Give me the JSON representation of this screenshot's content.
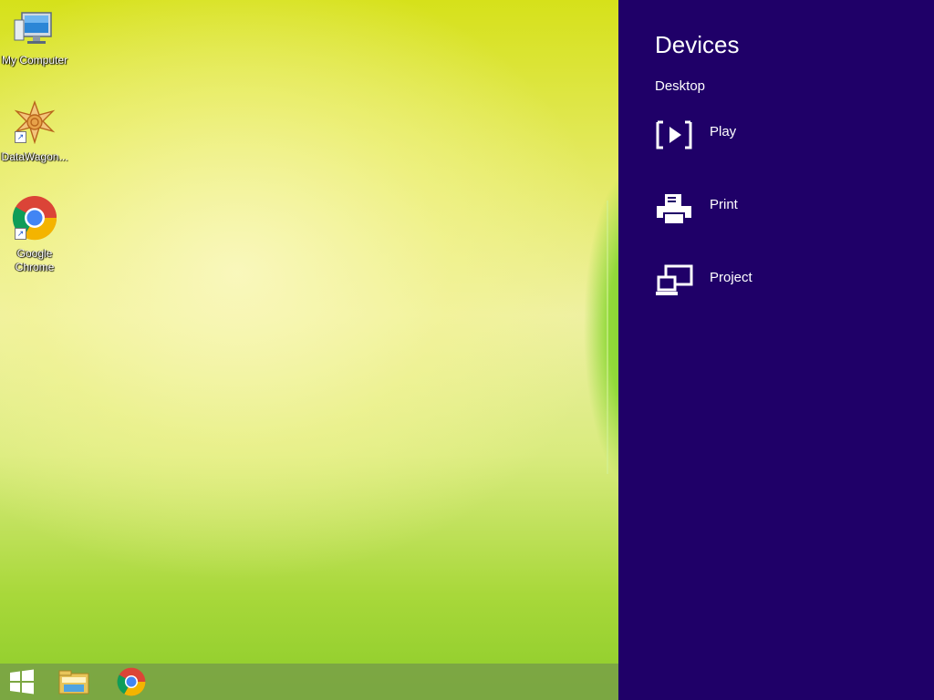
{
  "desktop": {
    "icons": [
      {
        "label": "My Computer",
        "icon": "my-computer-icon"
      },
      {
        "label": "DataWagon...",
        "icon": "datawagon-icon"
      },
      {
        "label": "Google\nChrome",
        "icon": "chrome-icon"
      }
    ]
  },
  "taskbar": {
    "items": [
      "start-icon",
      "file-explorer-icon",
      "chrome-icon"
    ]
  },
  "charm": {
    "title": "Devices",
    "subtitle": "Desktop",
    "items": [
      {
        "label": "Play",
        "icon": "play-icon"
      },
      {
        "label": "Print",
        "icon": "print-icon"
      },
      {
        "label": "Project",
        "icon": "project-icon"
      }
    ],
    "background": "#1f0068"
  }
}
